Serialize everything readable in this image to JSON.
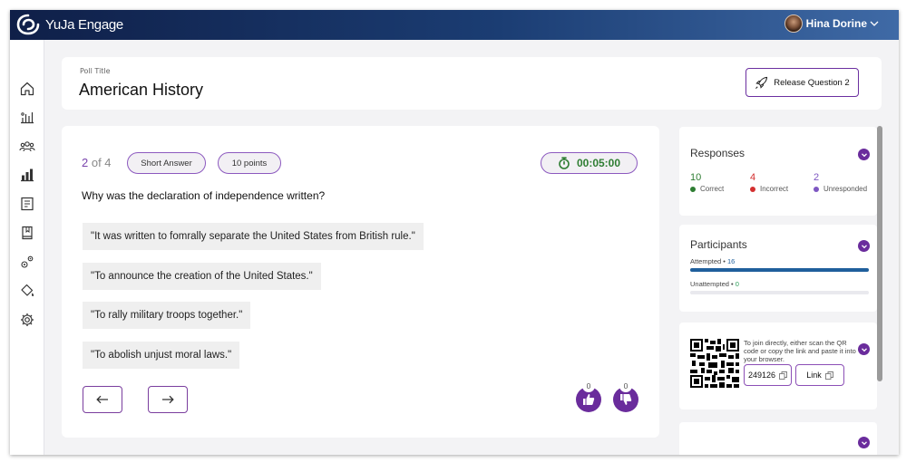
{
  "app": {
    "name": "YuJa Engage"
  },
  "user": {
    "name": "Hina Dorine"
  },
  "sidebar": {
    "items": [
      {
        "icon": "home-icon"
      },
      {
        "icon": "analytics-icon"
      },
      {
        "icon": "users-icon"
      },
      {
        "icon": "bar-chart-icon"
      },
      {
        "icon": "gradebook-icon"
      },
      {
        "icon": "book-icon"
      },
      {
        "icon": "integrations-icon"
      },
      {
        "icon": "paint-bucket-icon"
      },
      {
        "icon": "gear-icon"
      }
    ]
  },
  "header": {
    "poll_label": "Poll Title",
    "poll_title": "American History",
    "release_button": "Release Question 2"
  },
  "question": {
    "current": "2",
    "of_total": " of 4",
    "type": "Short Answer",
    "points": "10 points",
    "timer": "00:05:00",
    "text": "Why was the declaration of independence written?",
    "answers": [
      "\"It was written to fomrally separate the United States from British rule.\"",
      "\"To announce the creation of the United States.\"",
      "\"To rally military troops together.\"",
      "\"To abolish unjust moral laws.\""
    ],
    "likes": "0",
    "dislikes": "0"
  },
  "responses": {
    "title": "Responses",
    "correct": {
      "value": "10",
      "label": "Correct",
      "color": "#2e7d32"
    },
    "incorrect": {
      "value": "4",
      "label": "Incorrect",
      "color": "#d32f2f"
    },
    "unresponded": {
      "value": "2",
      "label": "Unresponded",
      "color": "#7e57c2"
    }
  },
  "participants": {
    "title": "Participants",
    "attempted_label": "Attempted • ",
    "attempted_value": "16",
    "attempted_fraction": 1.0,
    "unattempted_label": "Unattempted • ",
    "unattempted_value": "0",
    "unattempted_fraction": 0.0
  },
  "join": {
    "text": "To join directly, either scan the QR code or copy the link and paste it into your browser.",
    "code": "249126",
    "link_label": "Link"
  },
  "colors": {
    "accent": "#6a2c9c",
    "navbar": "#0f1f48"
  }
}
